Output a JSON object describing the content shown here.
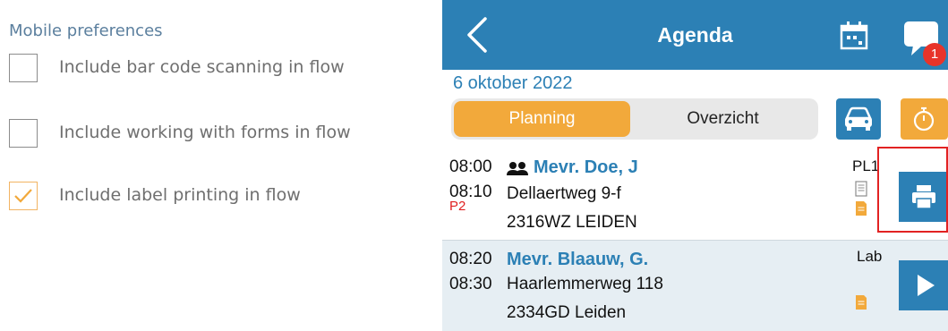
{
  "prefs": {
    "title": "Mobile preferences",
    "options": [
      {
        "label": "Include bar code scanning in flow",
        "checked": false
      },
      {
        "label": "Include working with forms in flow",
        "checked": false
      },
      {
        "label": "Include label printing in flow",
        "checked": true
      }
    ]
  },
  "app": {
    "header": {
      "title": "Agenda",
      "icons": [
        "back-chevron-icon",
        "calendar-icon",
        "chat-bubble-icon"
      ],
      "badge": "1"
    },
    "date": "6 oktober 2022",
    "tabs": {
      "planning": "Planning",
      "overview": "Overzicht",
      "active": "planning"
    },
    "actions": [
      "car-icon",
      "stopwatch-icon"
    ],
    "appointments": [
      {
        "start": "08:00",
        "end": "08:10",
        "priority": "P2",
        "name": "Mevr. Doe, J",
        "group": true,
        "street": "Dellaertweg 9-f",
        "postal_city": "2316WZ LEIDEN",
        "code": "PL1",
        "action": "printer-icon",
        "highlighted": true
      },
      {
        "start": "08:20",
        "end": "08:30",
        "priority": "",
        "name": "Mevr. Blaauw, G.",
        "group": false,
        "street": "Haarlemmerweg 118",
        "postal_city": "2334GD Leiden",
        "code": "Lab",
        "action": "play-icon",
        "highlighted": false
      }
    ],
    "colors": {
      "primary": "#2c80b5",
      "accent": "#f2a93b",
      "alert": "#e8342a"
    }
  }
}
